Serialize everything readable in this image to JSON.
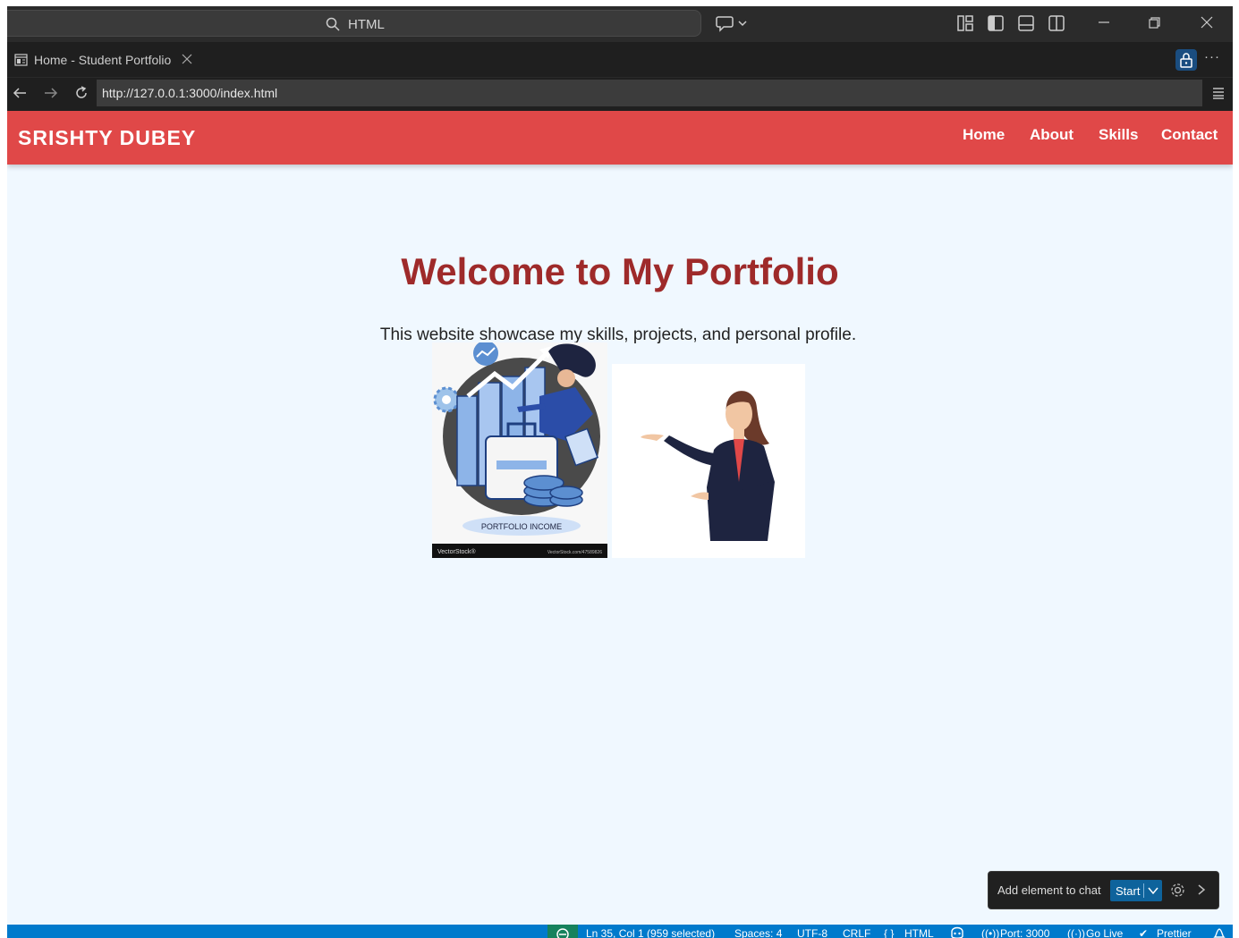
{
  "titlebar": {
    "search_text": "HTML"
  },
  "tab": {
    "label": "Home - Student Portfolio"
  },
  "browser": {
    "url": "http://127.0.0.1:3000/index.html"
  },
  "site": {
    "logo": "SRISHTY DUBEY",
    "nav": [
      "Home",
      "About",
      "Skills",
      "Contact"
    ],
    "nav_color": "#e04848",
    "background": "#f0f8ff",
    "hero_title": "Welcome to My Portfolio",
    "hero_title_color": "#9e2a2a",
    "hero_subtitle": "This website showcase my skills, projects, and personal profile.",
    "image1": {
      "caption": "PORTFOLIO INCOME",
      "watermark_left": "VectorStock®",
      "watermark_right": "VectorStock.com/47589826"
    }
  },
  "chat_popup": {
    "label": "Add element to chat",
    "start": "Start"
  },
  "statusbar": {
    "position": "Ln 35, Col 1 (959 selected)",
    "spaces": "Spaces: 4",
    "encoding": "UTF-8",
    "eol": "CRLF",
    "language": "HTML",
    "port": "Port: 3000",
    "golive": "Go Live",
    "prettier": "Prettier"
  },
  "colors": {
    "statusbar": "#007acc",
    "accent": "#0e639c"
  }
}
